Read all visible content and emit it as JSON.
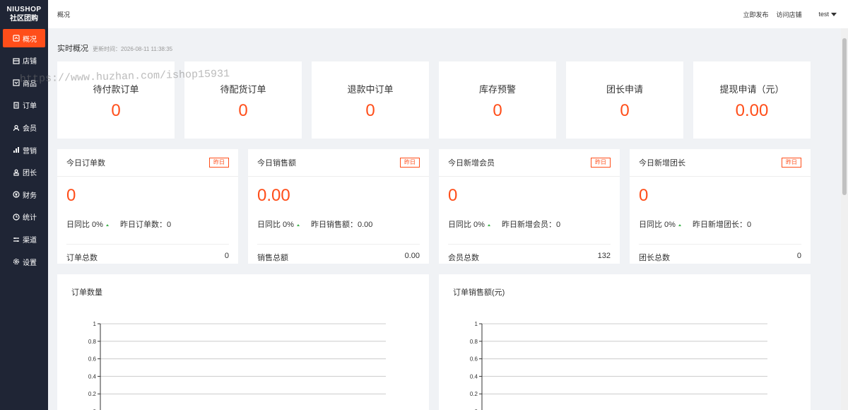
{
  "brand": {
    "line1": "NIUSHOP",
    "line2": "社区团购"
  },
  "sidebar": {
    "items": [
      {
        "label": "概况",
        "icon": "dashboard-icon",
        "active": true
      },
      {
        "label": "店铺",
        "icon": "shop-icon"
      },
      {
        "label": "商品",
        "icon": "goods-icon"
      },
      {
        "label": "订单",
        "icon": "order-icon"
      },
      {
        "label": "会员",
        "icon": "member-icon"
      },
      {
        "label": "营销",
        "icon": "marketing-icon"
      },
      {
        "label": "团长",
        "icon": "leader-icon"
      },
      {
        "label": "财务",
        "icon": "finance-icon"
      },
      {
        "label": "统计",
        "icon": "statistics-icon"
      },
      {
        "label": "渠道",
        "icon": "channel-icon"
      },
      {
        "label": "设置",
        "icon": "settings-icon"
      }
    ]
  },
  "header": {
    "breadcrumb": "概况",
    "publish": "立即发布",
    "visit_store": "访问店铺",
    "user": "test"
  },
  "realtime": {
    "title": "实时概况",
    "updated": "更新时间：2026-08-11 11:38:35"
  },
  "stats": [
    {
      "label": "待付款订单",
      "value": "0"
    },
    {
      "label": "待配货订单",
      "value": "0"
    },
    {
      "label": "退款中订单",
      "value": "0"
    },
    {
      "label": "库存预警",
      "value": "0"
    },
    {
      "label": "团长申请",
      "value": "0"
    },
    {
      "label": "提现申请（元）",
      "value": "0.00"
    }
  ],
  "today": [
    {
      "title": "今日订单数",
      "yesterday_btn": "昨日",
      "value": "0",
      "ratio": "日同比 0%",
      "yesterday": "昨日订单数：0",
      "total_label": "订单总数",
      "total_value": "0"
    },
    {
      "title": "今日销售额",
      "yesterday_btn": "昨日",
      "value": "0.00",
      "ratio": "日同比 0%",
      "yesterday": "昨日销售额：0.00",
      "total_label": "销售总额",
      "total_value": "0.00"
    },
    {
      "title": "今日新增会员",
      "yesterday_btn": "昨日",
      "value": "0",
      "ratio": "日同比 0%",
      "yesterday": "昨日新增会员：0",
      "total_label": "会员总数",
      "total_value": "132"
    },
    {
      "title": "今日新增团长",
      "yesterday_btn": "昨日",
      "value": "0",
      "ratio": "日同比 0%",
      "yesterday": "昨日新增团长：0",
      "total_label": "团长总数",
      "total_value": "0"
    }
  ],
  "charts": {
    "order_count_title": "订单数量",
    "order_sales_title": "订单销售额(元)"
  },
  "chart_data": [
    {
      "type": "line",
      "title": "订单数量",
      "xlabel": "",
      "ylabel": "",
      "ylim": [
        0,
        1
      ],
      "y_ticks": [
        "1",
        "0.8",
        "0.6",
        "0.4",
        "0.2",
        "0"
      ],
      "series": [],
      "grid": true
    },
    {
      "type": "line",
      "title": "订单销售额(元)",
      "xlabel": "",
      "ylabel": "",
      "ylim": [
        0,
        1
      ],
      "y_ticks": [
        "1",
        "0.8",
        "0.6",
        "0.4",
        "0.2",
        "0"
      ],
      "series": [],
      "grid": true
    }
  ],
  "watermark": "https://www.huzhan.com/ishop15931",
  "colors": {
    "accent": "#ff4e1a",
    "sidebar_bg": "#1f2535",
    "up": "#3cb34a"
  }
}
